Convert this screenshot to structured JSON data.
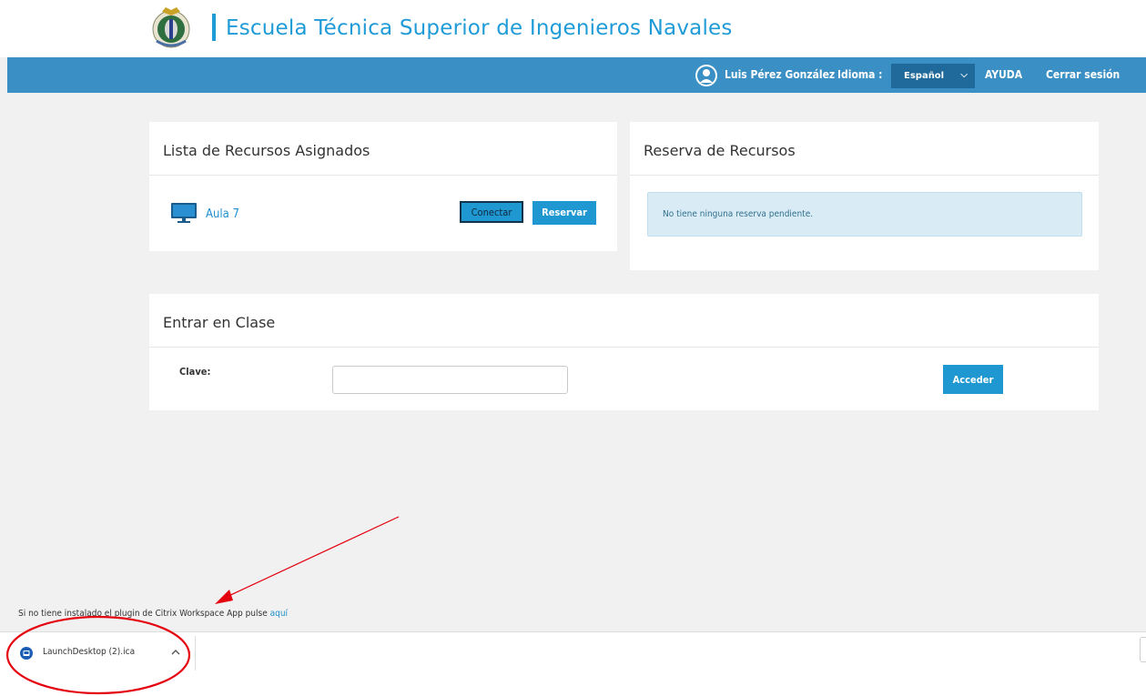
{
  "header": {
    "title": "Escuela Técnica Superior de Ingenieros Navales",
    "logo_icon": "crest-icon",
    "brand_color": "#1f9bd7"
  },
  "navbar": {
    "user_name": "Luis Pérez González",
    "language_label": "Idioma :",
    "language_value": "Español",
    "help_label": "AYUDA",
    "logout_label": "Cerrar sesión",
    "bar_color": "#3a8fc4"
  },
  "assigned_resources": {
    "title": "Lista de Recursos Asignados",
    "items": [
      {
        "name": "Aula 7",
        "icon": "monitor-icon",
        "connect_label": "Conectar",
        "reserve_label": "Reservar"
      }
    ]
  },
  "reservations": {
    "title": "Reserva de Recursos",
    "message": "No tiene ninguna reserva pendiente."
  },
  "join_class": {
    "title": "Entrar en Clase",
    "key_label": "Clave:",
    "key_value": "",
    "submit_label": "Acceder"
  },
  "plugin_note": {
    "text": "Si no tiene instalado el plugin de Citrix Workspace App pulse",
    "link_text": "aquí"
  },
  "download_bar": {
    "file_name": "LaunchDesktop (2).ica",
    "file_icon": "citrix-file-icon"
  },
  "annotation": {
    "color": "#e3000f"
  }
}
